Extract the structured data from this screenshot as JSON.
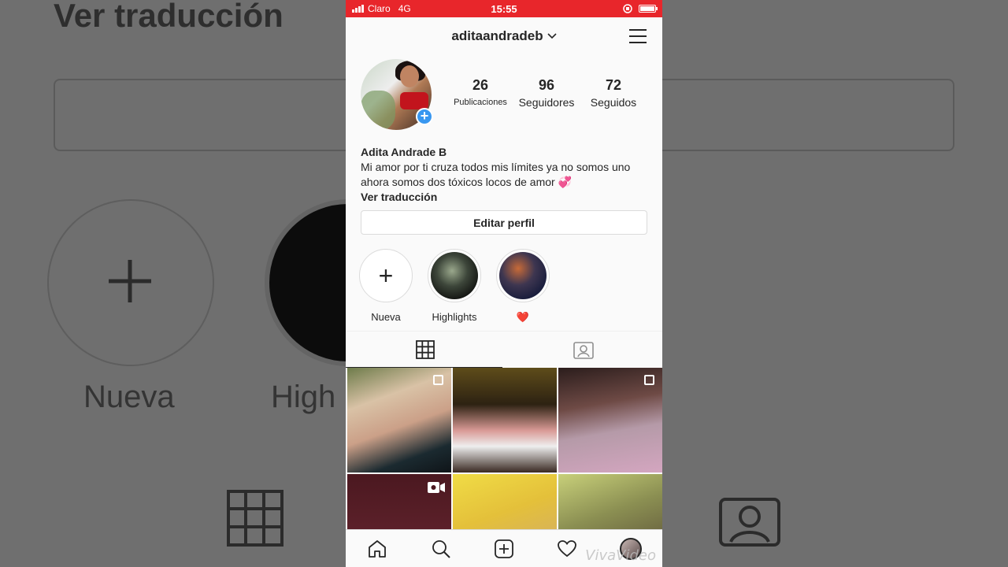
{
  "background": {
    "title": "Ver traducción",
    "nueva": "Nueva",
    "highlights_partial": "High"
  },
  "status_bar": {
    "carrier": "Claro",
    "network": "4G",
    "time": "15:55"
  },
  "header": {
    "username": "aditaandradeb",
    "menu_icon": "hamburger-icon"
  },
  "profile": {
    "stats": [
      {
        "value": "26",
        "label": "Publicaciones"
      },
      {
        "value": "96",
        "label": "Seguidores"
      },
      {
        "value": "72",
        "label": "Seguidos"
      }
    ],
    "name": "Adita Andrade B",
    "bio": "Mi amor por ti cruza todos mis límites ya no somos uno ahora somos dos tóxicos locos de amor 💞",
    "translate": "Ver traducción",
    "edit_button": "Editar perfil"
  },
  "highlights": [
    {
      "label": "Nueva"
    },
    {
      "label": "Highlights"
    },
    {
      "label": "❤️"
    }
  ],
  "tabs": [
    {
      "icon": "grid-icon",
      "active": true
    },
    {
      "icon": "tagged-person-icon",
      "active": false
    }
  ],
  "grid": {
    "posts": [
      {
        "type": "carousel"
      },
      {
        "type": "photo"
      },
      {
        "type": "carousel"
      },
      {
        "type": "video"
      },
      {
        "type": "photo"
      },
      {
        "type": "photo"
      }
    ]
  },
  "bottom_nav": [
    {
      "icon": "home-icon"
    },
    {
      "icon": "search-icon"
    },
    {
      "icon": "add-post-icon"
    },
    {
      "icon": "heart-icon"
    },
    {
      "icon": "profile-avatar"
    }
  ],
  "watermark": "VivaVideo",
  "colors": {
    "status_bar": "#e8262b",
    "accent_blue": "#3897f0",
    "text": "#262626"
  }
}
